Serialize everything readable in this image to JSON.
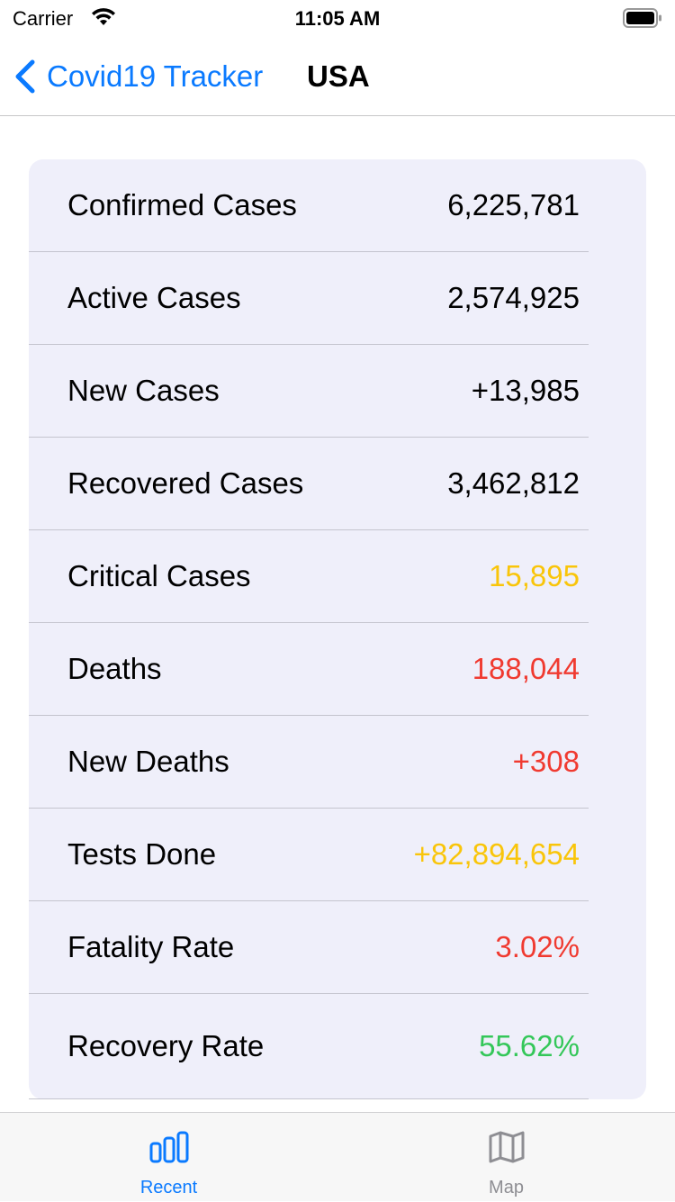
{
  "status_bar": {
    "carrier": "Carrier",
    "time": "11:05 AM"
  },
  "nav": {
    "back_label": "Covid19 Tracker",
    "title": "USA",
    "accent_color": "#0a7aff"
  },
  "stats": [
    {
      "label": "Confirmed Cases",
      "value": "6,225,781",
      "color": "#000000"
    },
    {
      "label": "Active Cases",
      "value": "2,574,925",
      "color": "#000000"
    },
    {
      "label": "New Cases",
      "value": "+13,985",
      "color": "#000000"
    },
    {
      "label": "Recovered Cases",
      "value": "3,462,812",
      "color": "#000000"
    },
    {
      "label": "Critical Cases",
      "value": "15,895",
      "color": "#f9c50a"
    },
    {
      "label": "Deaths",
      "value": "188,044",
      "color": "#f03a30"
    },
    {
      "label": "New Deaths",
      "value": "+308",
      "color": "#f03a30"
    },
    {
      "label": "Tests Done",
      "value": "+82,894,654",
      "color": "#f9c50a"
    },
    {
      "label": "Fatality Rate",
      "value": "3.02%",
      "color": "#f03a30"
    },
    {
      "label": "Recovery Rate",
      "value": "55.62%",
      "color": "#34c759"
    }
  ],
  "tabs": [
    {
      "label": "Recent",
      "icon": "bar-chart-icon",
      "selected": true
    },
    {
      "label": "Map",
      "icon": "map-icon",
      "selected": false
    }
  ]
}
